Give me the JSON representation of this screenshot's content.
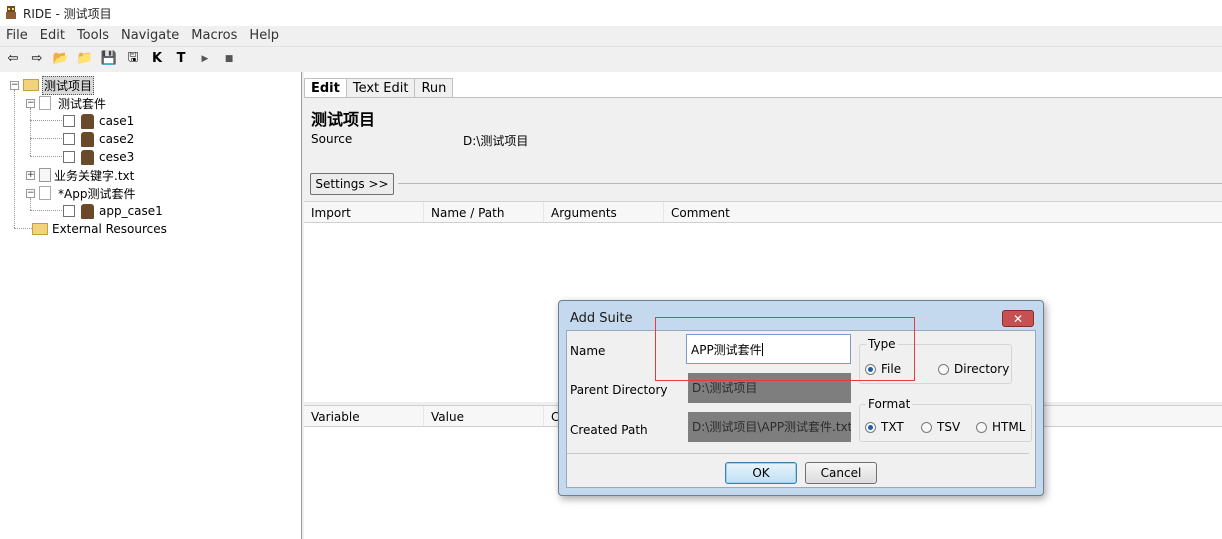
{
  "window": {
    "title": "RIDE - 测试项目",
    "icon": "robot-icon"
  },
  "menu": [
    "File",
    "Edit",
    "Tools",
    "Navigate",
    "Macros",
    "Help"
  ],
  "toolbar": {
    "icons": [
      "back-arrow-icon",
      "forward-arrow-icon",
      "open-test-suite-icon",
      "open-directory-icon",
      "save-icon",
      "save-all-icon",
      "search-keywords-icon",
      "search-tests-icon",
      "run-icon",
      "stop-icon"
    ],
    "glyphs": [
      "⇦",
      "⇨",
      "📂",
      "📁",
      "💾",
      "🖫",
      "K",
      "T",
      "▶",
      "■"
    ]
  },
  "tree": {
    "root": "测试项目",
    "suite1": "测试套件",
    "cases1": [
      "case1",
      "case2",
      "cese3"
    ],
    "resource": "业务关键字.txt",
    "suite2": "*App测试套件",
    "cases2": [
      "app_case1"
    ],
    "external": "External Resources"
  },
  "editor": {
    "tabs": [
      "Edit",
      "Text Edit",
      "Run"
    ],
    "suite_name": "测试项目",
    "source_label": "Source",
    "source_value": "D:\\测试项目",
    "settings_button": "Settings >>",
    "import_columns": [
      "Import",
      "Name / Path",
      "Arguments",
      "Comment"
    ],
    "variable_columns": [
      "Variable",
      "Value",
      "C"
    ]
  },
  "dialog": {
    "title": "Add Suite",
    "close": "✕",
    "name_label": "Name",
    "name_value": "APP测试套件",
    "parent_label": "Parent Directory",
    "parent_value": "D:\\测试项目",
    "created_label": "Created Path",
    "created_value": "D:\\测试项目\\APP测试套件.txt",
    "type_title": "Type",
    "type_options": [
      "File",
      "Directory"
    ],
    "type_selected": "File",
    "format_title": "Format",
    "format_options": [
      "TXT",
      "TSV",
      "HTML"
    ],
    "format_selected": "TXT",
    "ok": "OK",
    "cancel": "Cancel"
  },
  "colors": {
    "highlight_border": "#e83b3b",
    "selected_radio": "#1d5fa8",
    "dialog_frame": "#c4d8ee"
  }
}
